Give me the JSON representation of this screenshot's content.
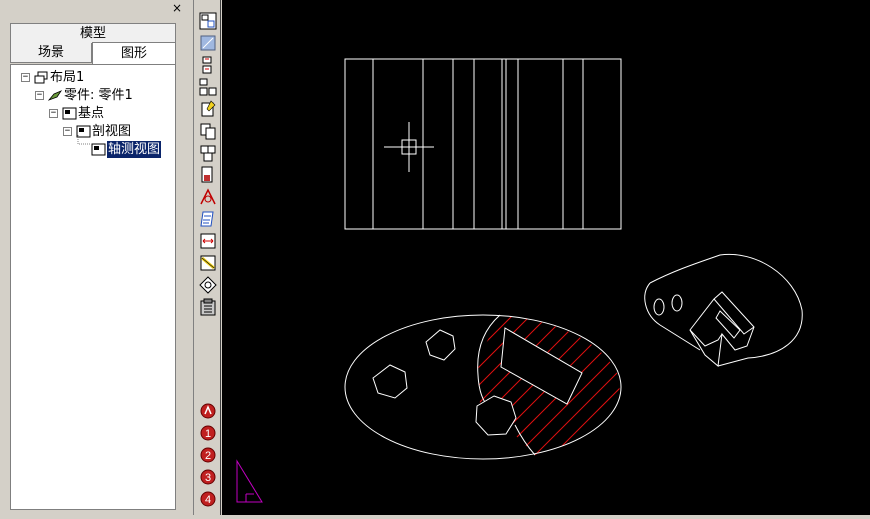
{
  "panel": {
    "close_label": "×",
    "tab_model": "模型",
    "tab_scene": "场景",
    "tab_graphics": "图形"
  },
  "tree": {
    "items": [
      {
        "label": "布局1",
        "expander": "−",
        "icon": "layout-icon"
      },
      {
        "label": "零件: 零件1",
        "expander": "−",
        "icon": "part-icon"
      },
      {
        "label": "基点",
        "expander": "−",
        "icon": "view-icon"
      },
      {
        "label": "剖视图",
        "expander": "−",
        "icon": "view-icon"
      },
      {
        "label": "轴测视图",
        "expander": "",
        "icon": "view-icon",
        "selected": true
      }
    ]
  },
  "toolbar": {
    "icons": [
      "standard-view-icon",
      "projection-view-icon",
      "section-view-icon",
      "partial-view-icon",
      "detail-view-icon",
      "auxiliary-view-icon",
      "broken-view-icon",
      "local-section-icon",
      "dimension-icon",
      "annotation-icon",
      "align-view-icon",
      "edit-view-icon",
      "property-icon",
      "clipboard-icon",
      "view-1-icon",
      "view-2-icon",
      "view-3-icon",
      "view-4-icon",
      "view-5-icon"
    ],
    "numbers": [
      "1",
      "2",
      "3",
      "4"
    ]
  },
  "colors": {
    "canvas_bg": "#000000",
    "drawing_line": "#ffffff",
    "hatch": "#e01010",
    "ucs_icon": "#c000c0",
    "selection": "#0a246a"
  }
}
